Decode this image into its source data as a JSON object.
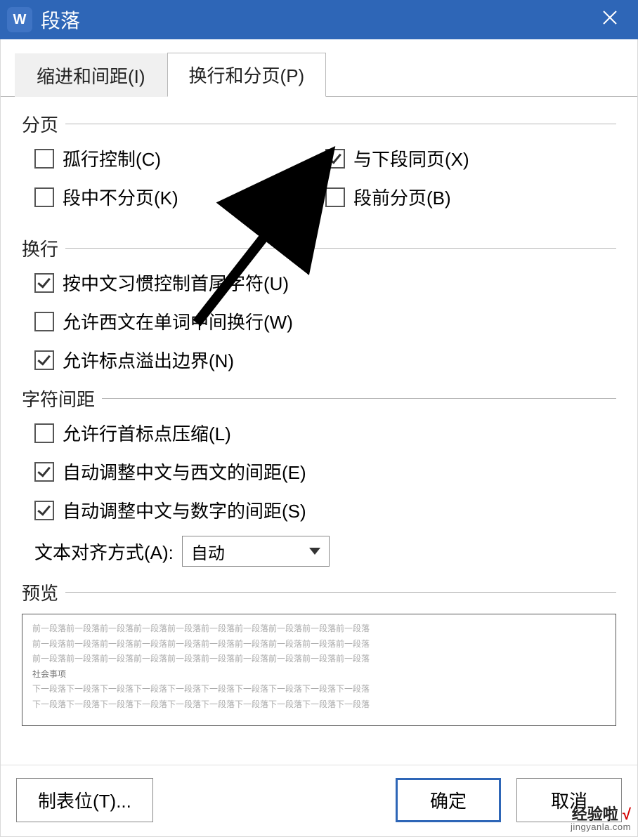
{
  "titlebar": {
    "app_icon_letter": "W",
    "title": "段落"
  },
  "tabs": {
    "indent": "缩进和间距(I)",
    "page": "换行和分页(P)"
  },
  "sections": {
    "pagination": {
      "title": "分页",
      "widow": "孤行控制(C)",
      "keepwith": "与下段同页(X)",
      "keeplines": "段中不分页(K)",
      "pagebreak": "段前分页(B)"
    },
    "wrap": {
      "title": "换行",
      "cjk": "按中文习惯控制首尾字符(U)",
      "latin": "允许西文在单词中间换行(W)",
      "punct": "允许标点溢出边界(N)"
    },
    "spacing": {
      "title": "字符间距",
      "compress": "允许行首标点压缩(L)",
      "cjklatin": "自动调整中文与西文的间距(E)",
      "cjknum": "自动调整中文与数字的间距(S)",
      "align_label": "文本对齐方式(A):",
      "align_value": "自动"
    },
    "preview": {
      "title": "预览",
      "grey_line": "前一段落前一段落前一段落前一段落前一段落前一段落前一段落前一段落前一段落前一段落",
      "highlight": "社会事项",
      "grey_line2": "下一段落下一段落下一段落下一段落下一段落下一段落下一段落下一段落下一段落下一段落"
    }
  },
  "footer": {
    "tabs_btn": "制表位(T)...",
    "ok": "确定",
    "cancel": "取消"
  },
  "watermark": {
    "line1a": "经验啦",
    "line1b": "√",
    "line2": "jingyanla.com"
  }
}
